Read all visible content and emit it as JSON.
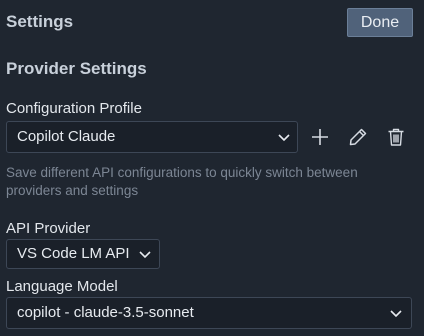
{
  "header": {
    "title": "Settings",
    "done_label": "Done"
  },
  "provider_settings": {
    "section_title": "Provider Settings",
    "profile": {
      "label": "Configuration Profile",
      "selected": "Copilot Claude",
      "description": "Save different API configurations to quickly switch between providers and settings",
      "actions": {
        "add_icon": "plus-icon",
        "edit_icon": "pencil-icon",
        "delete_icon": "trash-icon"
      }
    },
    "api_provider": {
      "label": "API Provider",
      "selected": "VS Code LM API"
    },
    "language_model": {
      "label": "Language Model",
      "selected": "copilot - claude-3.5-sonnet"
    }
  },
  "colors": {
    "background": "#1f2630",
    "button": "#50627a",
    "dropdown_bg": "#1a2029",
    "muted_text": "#7c8694"
  }
}
